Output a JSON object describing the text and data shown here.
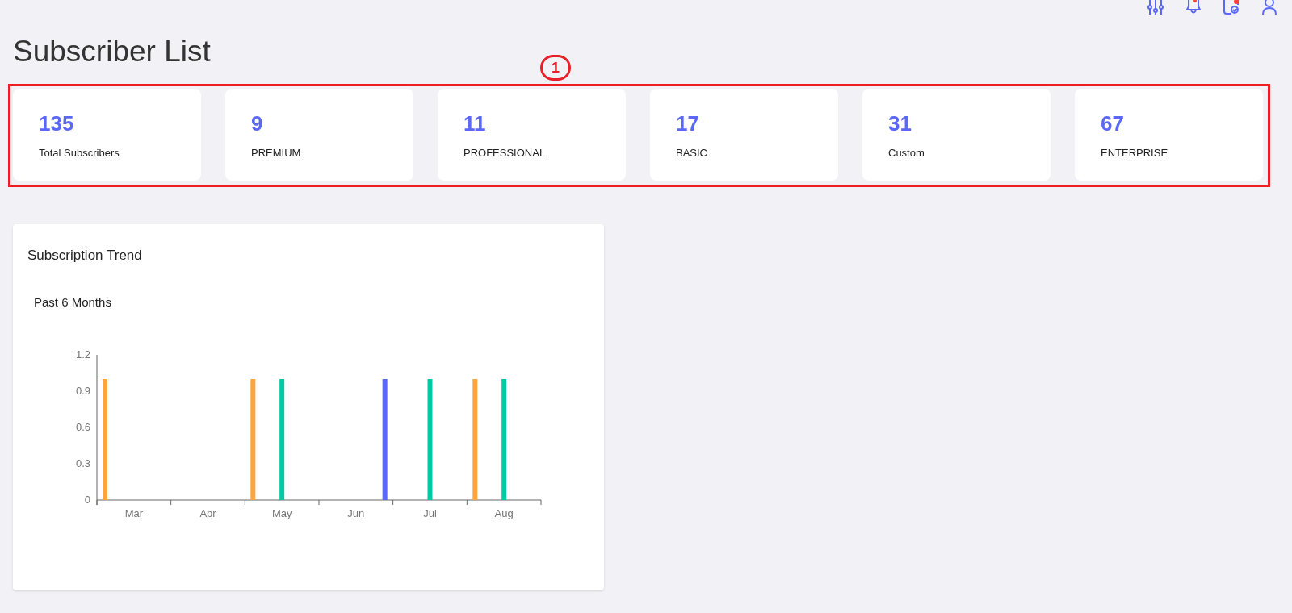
{
  "page_title": "Subscriber List",
  "annotation": {
    "label": "1"
  },
  "stats": [
    {
      "value": "135",
      "label": "Total Subscribers"
    },
    {
      "value": "9",
      "label": "PREMIUM"
    },
    {
      "value": "11",
      "label": "PROFESSIONAL"
    },
    {
      "value": "17",
      "label": "BASIC"
    },
    {
      "value": "31",
      "label": "Custom"
    },
    {
      "value": "67",
      "label": "ENTERPRISE"
    }
  ],
  "trend_card": {
    "title": "Subscription Trend",
    "subtitle": "Past 6 Months",
    "chart_data": {
      "type": "bar",
      "categories": [
        "Mar",
        "Apr",
        "May",
        "Jun",
        "Jul",
        "Aug"
      ],
      "ylim": [
        0,
        1.2
      ],
      "yticks": [
        0,
        0.3,
        0.6,
        0.9,
        1.2
      ],
      "series": [
        {
          "color": "#ffa53c",
          "values": [
            1,
            null,
            1,
            null,
            null,
            1
          ]
        },
        {
          "color": "#00cba6",
          "values": [
            null,
            null,
            1,
            null,
            1,
            1
          ]
        },
        {
          "color": "#5b67f7",
          "values": [
            null,
            null,
            null,
            1,
            null,
            null
          ]
        }
      ]
    }
  }
}
